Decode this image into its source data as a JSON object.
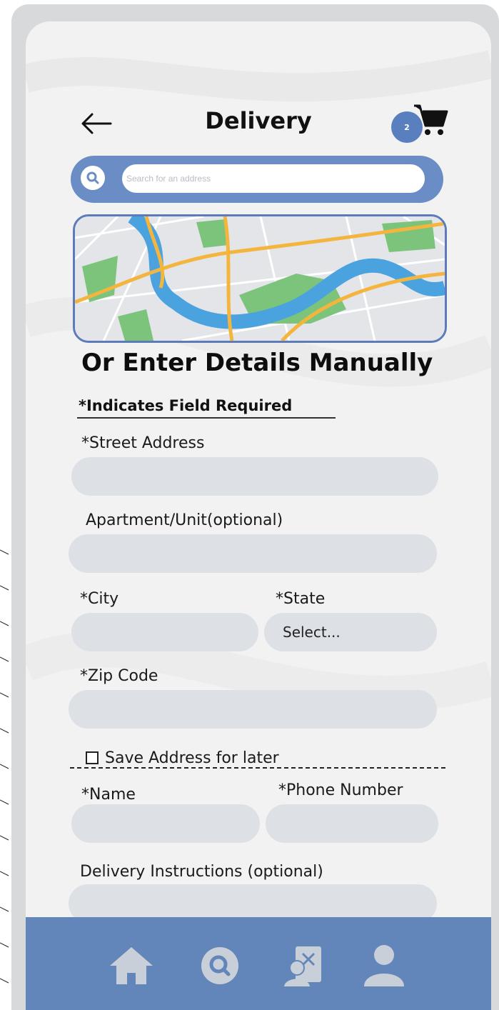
{
  "header": {
    "title": "Delivery",
    "cart_count": "2"
  },
  "search": {
    "placeholder": "Search for an address"
  },
  "form": {
    "section_heading": "Or Enter Details Manually",
    "required_note": "*Indicates Field Required",
    "street_label": "*Street Address",
    "apartment_label": "Apartment/Unit(optional)",
    "city_label": "*City",
    "state_label": "*State",
    "state_value": "Select...",
    "zip_label": "*Zip Code",
    "save_address_label": "Save Address for later",
    "name_label": "*Name",
    "phone_label": "*Phone Number",
    "instructions_label": "Delivery Instructions (optional)"
  },
  "nav": {
    "items": [
      {
        "icon": "home-icon"
      },
      {
        "icon": "search-icon"
      },
      {
        "icon": "menu-icon"
      },
      {
        "icon": "profile-icon"
      }
    ]
  },
  "colors": {
    "accent": "#6a8dc5",
    "nav_bar": "#6386ba",
    "field_bg": "#dde0e4",
    "map_water": "#4aa3df",
    "map_road": "#f4b53f",
    "map_park": "#7cc47c"
  }
}
